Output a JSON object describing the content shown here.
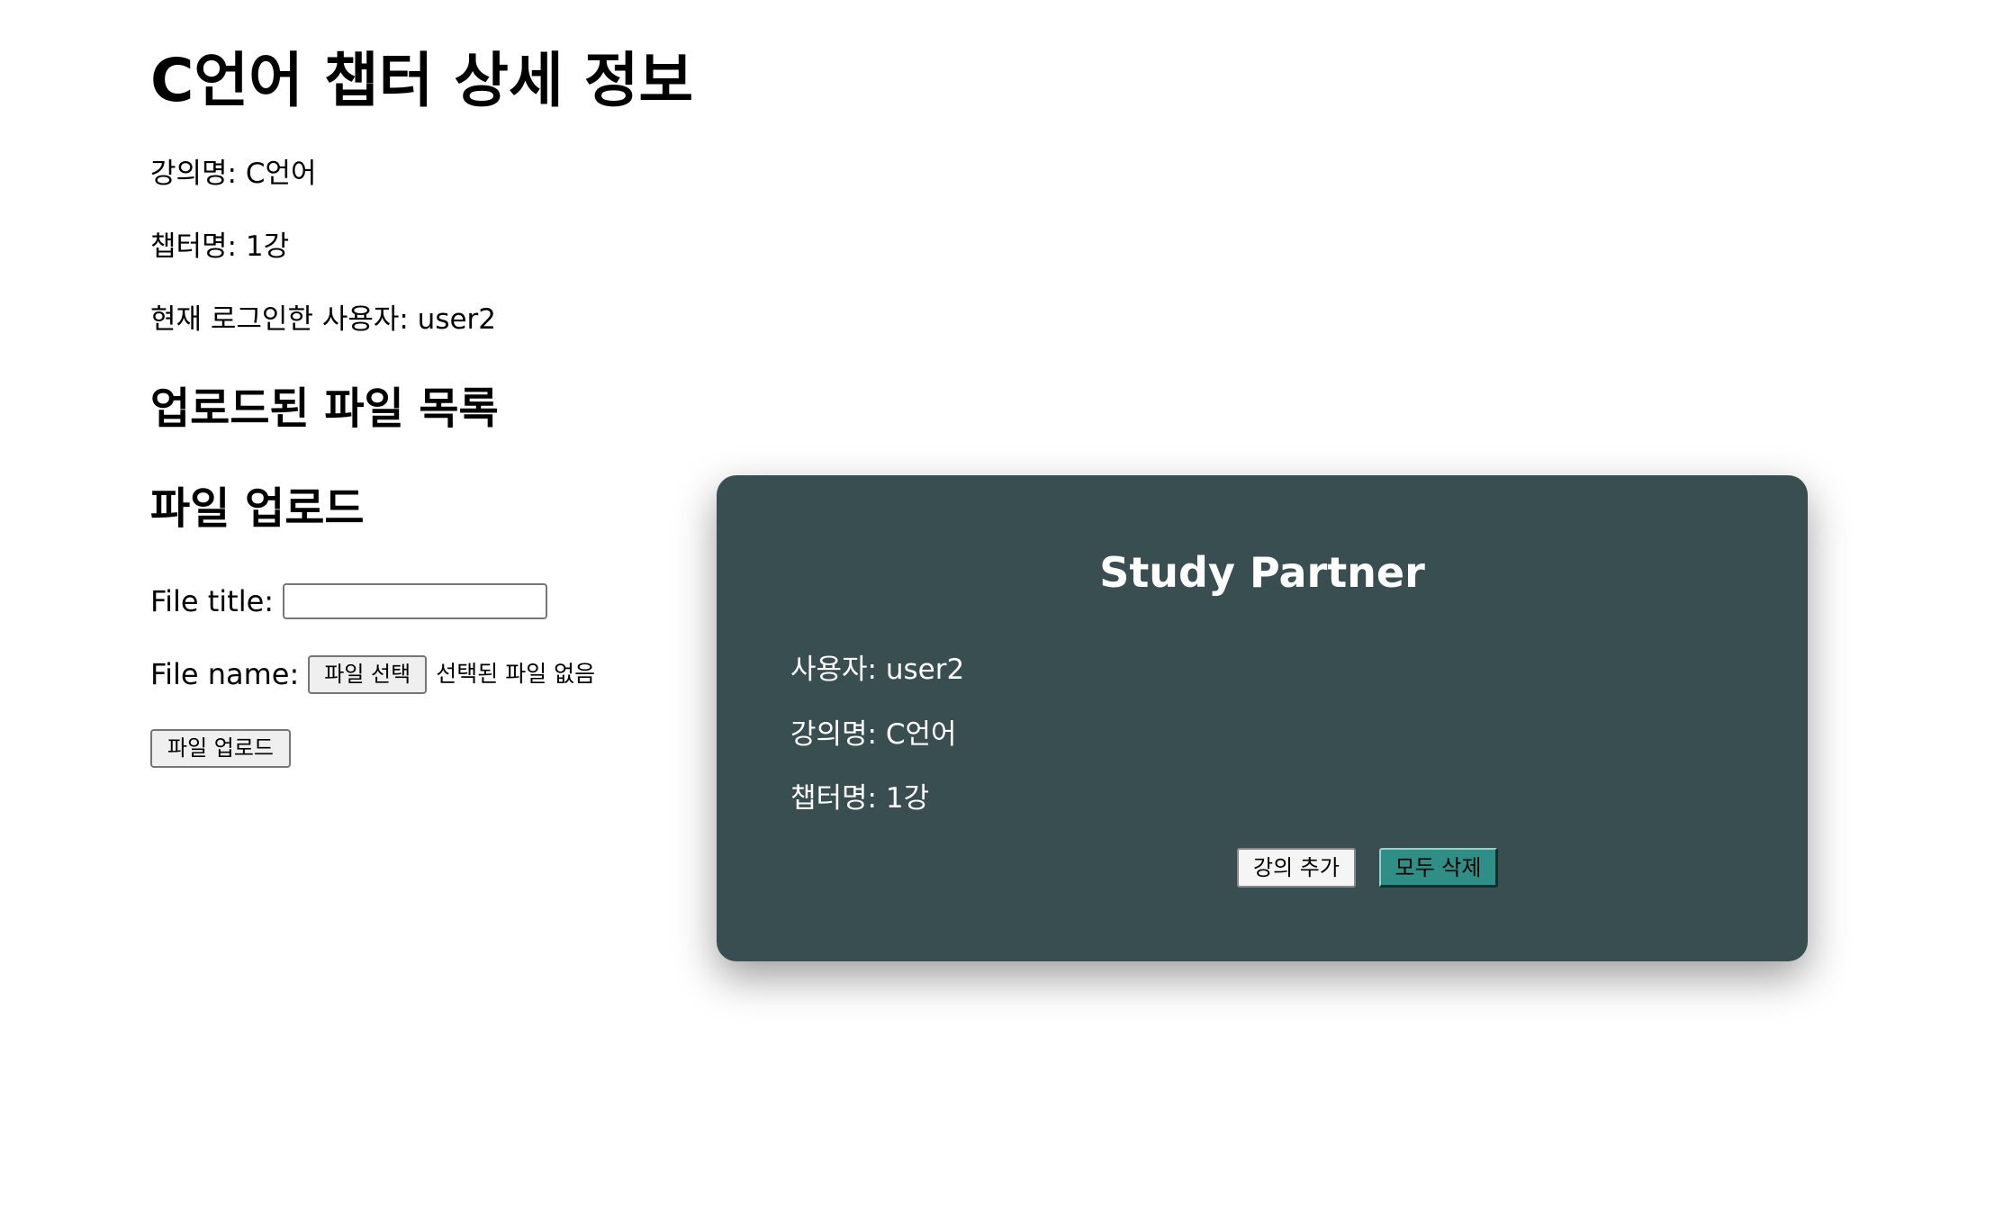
{
  "page": {
    "title": "C언어 챕터 상세 정보",
    "course_line": "강의명: C언어",
    "chapter_line": "챕터명: 1강",
    "user_line": "현재 로그인한 사용자: user2"
  },
  "files_section": {
    "heading": "업로드된 파일 목록"
  },
  "upload_section": {
    "heading": "파일 업로드",
    "title_label": "File title:",
    "title_value": "",
    "file_label": "File name:",
    "choose_file_label": "파일 선택",
    "no_file_text": "선택된 파일 없음",
    "upload_label": "파일 업로드"
  },
  "card": {
    "title": "Study Partner",
    "user_line": "사용자: user2",
    "course_line": "강의명: C언어",
    "chapter_line": "챕터명: 1강",
    "add_course_label": "강의 추가",
    "delete_all_label": "모두 삭제"
  },
  "colors": {
    "card_background": "#384e50",
    "delete_button": "#2f8f86"
  }
}
